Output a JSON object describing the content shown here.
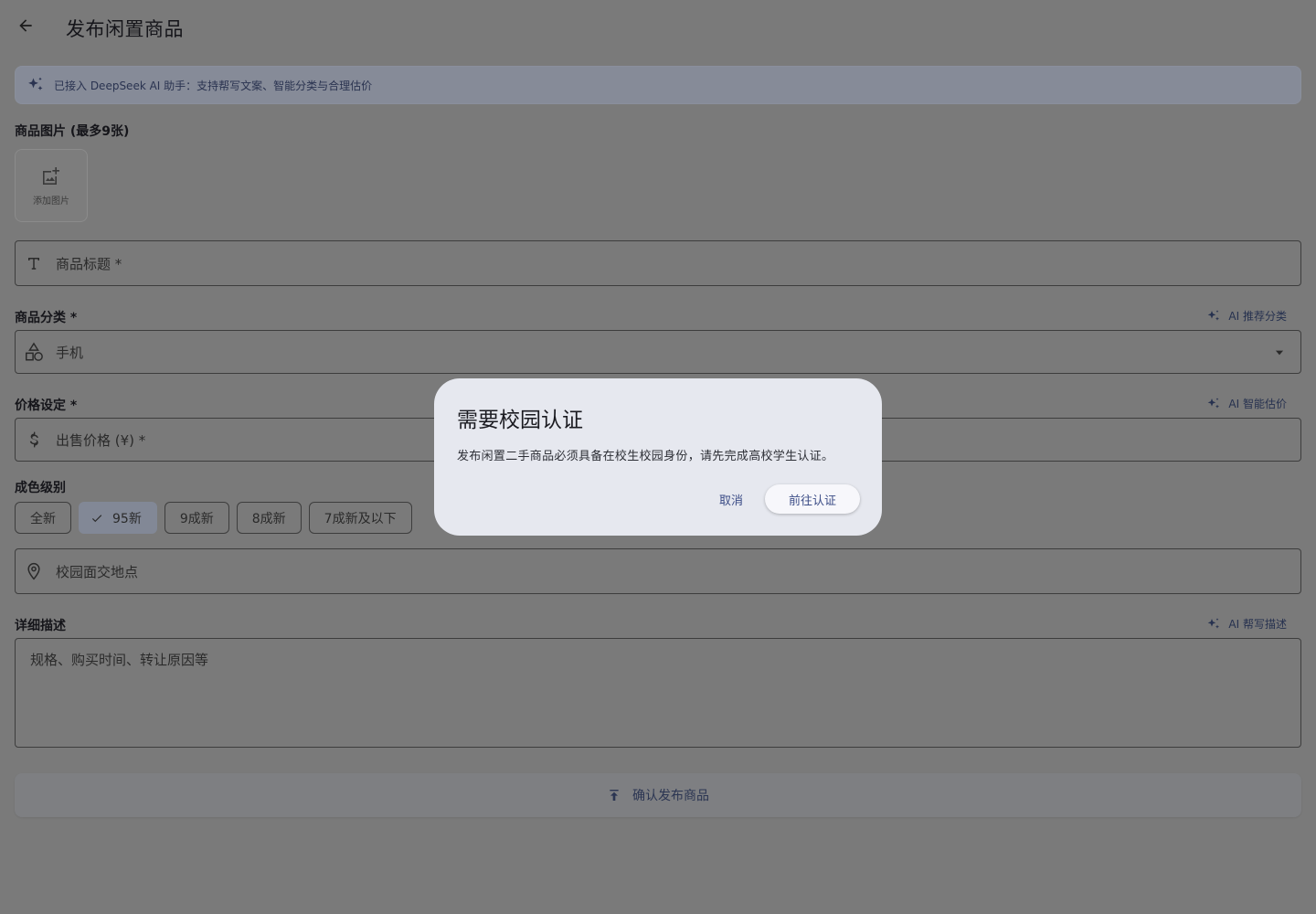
{
  "appbar": {
    "title": "发布闲置商品"
  },
  "ai_banner": {
    "text": "已接入 DeepSeek AI 助手：支持帮写文案、智能分类与合理估价"
  },
  "photos": {
    "label": "商品图片 (最多9张)",
    "add_label": "添加图片"
  },
  "title_field": {
    "placeholder": "商品标题 *"
  },
  "category": {
    "label": "商品分类 *",
    "ai_link": "AI 推荐分类",
    "value": "手机"
  },
  "price": {
    "label": "价格设定 *",
    "ai_link": "AI 智能估价",
    "placeholder": "出售价格 (¥) *"
  },
  "condition": {
    "label": "成色级别",
    "options": [
      "全新",
      "95新",
      "9成新",
      "8成新",
      "7成新及以下"
    ],
    "selected": "95新"
  },
  "location": {
    "placeholder": "校园面交地点"
  },
  "description": {
    "label": "详细描述",
    "ai_link": "AI 帮写描述",
    "placeholder": "规格、购买时间、转让原因等"
  },
  "submit": {
    "label": "确认发布商品"
  },
  "dialog": {
    "title": "需要校园认证",
    "body": "发布闲置二手商品必须具备在校生校园身份，请先完成高校学生认证。",
    "cancel": "取消",
    "confirm": "前往认证"
  },
  "colors": {
    "scrim": "#7a7a7a",
    "dialog_bg": "#e6e8ef",
    "accent": "#3b4c86"
  }
}
